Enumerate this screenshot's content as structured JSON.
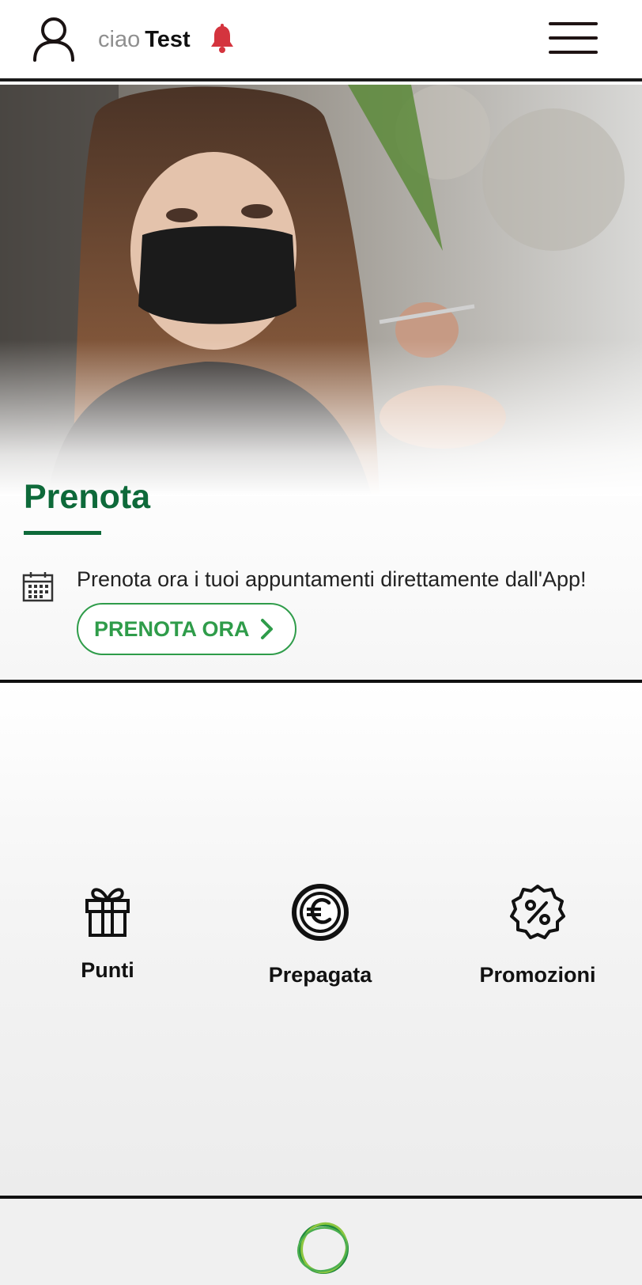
{
  "header": {
    "greeting_prefix": "ciao",
    "user_name": "Test",
    "icons": {
      "profile": "user-icon",
      "notifications": "bell-icon",
      "menu": "hamburger-menu-icon"
    },
    "colors": {
      "bell": "#d4343e"
    }
  },
  "hero": {
    "image": "hairdresser wearing black face mask cutting hair with scissors",
    "title": "Prenota",
    "description": "Prenota ora i tuoi appuntamenti direttamente dall'App!",
    "button_label": "PRENOTA ORA",
    "icons": {
      "description": "calendar-icon",
      "button": "chevron-right-icon"
    },
    "colors": {
      "title": "#0e6a3a",
      "button": "#2f9c4a"
    }
  },
  "actions": [
    {
      "label": "Punti",
      "icon": "gift-icon"
    },
    {
      "label": "Prepagata",
      "icon": "euro-coin-icon"
    },
    {
      "label": "Promozioni",
      "icon": "percent-badge-icon"
    }
  ],
  "bottom_bar": {
    "icon": "ring-logo-icon",
    "colors": {
      "ring_dark": "#1f8a3c",
      "ring_light": "#8cc63f"
    }
  }
}
